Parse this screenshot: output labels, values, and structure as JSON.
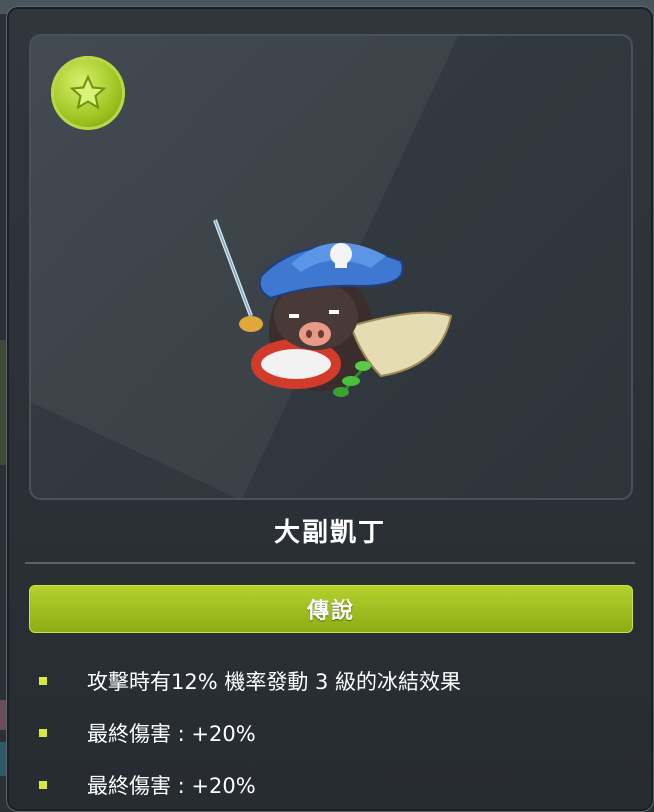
{
  "pet": {
    "name": "大副凱丁",
    "rank": "傳說",
    "badge_icon": "star-icon",
    "rank_color": "#9cbd1c"
  },
  "effects": [
    "攻擊時有12% 機率發動 3 級的冰結效果",
    "最終傷害 : +20%",
    "最終傷害 : +20%"
  ],
  "colors": {
    "bullet": "#d7ea3a",
    "panel": "#2c3237"
  }
}
